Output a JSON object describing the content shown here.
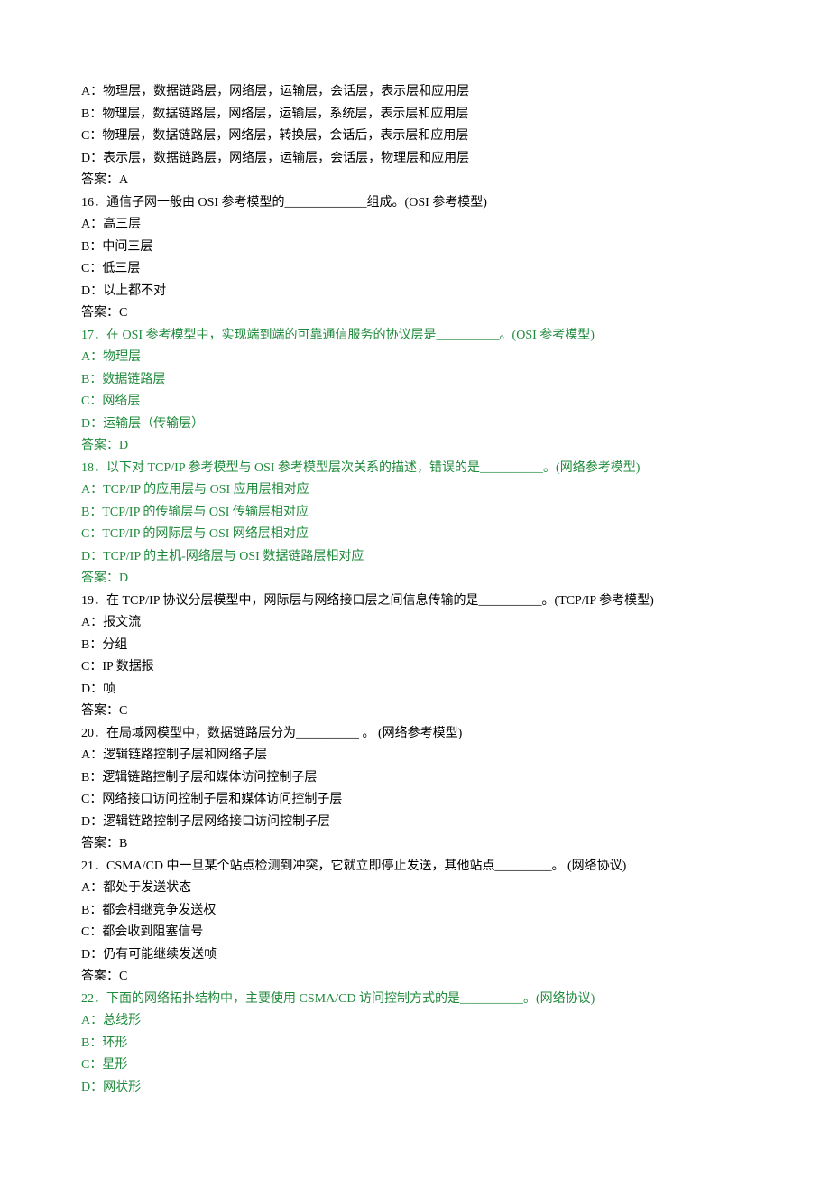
{
  "lines": [
    {
      "text": "A：物理层，数据链路层，网络层，运输层，会话层，表示层和应用层",
      "color": null
    },
    {
      "text": "B：物理层，数据链路层，网络层，运输层，系统层，表示层和应用层",
      "color": null
    },
    {
      "text": "C：物理层，数据链路层，网络层，转换层，会话后，表示层和应用层",
      "color": null
    },
    {
      "text": "D：表示层，数据链路层，网络层，运输层，会话层，物理层和应用层",
      "color": null
    },
    {
      "text": "答案：A",
      "color": null
    },
    {
      "text": "16．通信子网一般由 OSI 参考模型的_____________组成。(OSI 参考模型)",
      "color": null
    },
    {
      "text": "A：高三层",
      "color": null
    },
    {
      "text": "B：中间三层",
      "color": null
    },
    {
      "text": "C：低三层",
      "color": null
    },
    {
      "text": "D：以上都不对",
      "color": null
    },
    {
      "text": "答案：C",
      "color": null
    },
    {
      "text": "17．在 OSI 参考模型中，实现端到端的可靠通信服务的协议层是__________。(OSI 参考模型)",
      "color": "ci"
    },
    {
      "text": "A：物理层",
      "color": "ci"
    },
    {
      "text": "B：数据链路层",
      "color": "ci"
    },
    {
      "text": "C：网络层",
      "color": "ci"
    },
    {
      "text": "D：运输层（传输层）",
      "color": "ci"
    },
    {
      "text": "答案：D",
      "color": "ci"
    },
    {
      "text": "18．以下对 TCP/IP 参考模型与 OSI 参考模型层次关系的描述，错误的是__________。(网络参考模型)",
      "color": "ci"
    },
    {
      "text": "A：TCP/IP 的应用层与 OSI 应用层相对应",
      "color": "ci"
    },
    {
      "text": "B：TCP/IP 的传输层与 OSI 传输层相对应",
      "color": "ci"
    },
    {
      "text": "C：TCP/IP 的网际层与 OSI 网络层相对应",
      "color": "ci"
    },
    {
      "text": "D：TCP/IP 的主机-网络层与 OSI 数据链路层相对应",
      "color": "ci"
    },
    {
      "text": "答案：D",
      "color": "ci"
    },
    {
      "text": "19．在 TCP/IP 协议分层模型中，网际层与网络接口层之间信息传输的是__________。(TCP/IP 参考模型)",
      "color": null
    },
    {
      "text": "A：报文流",
      "color": null
    },
    {
      "text": "B：分组",
      "color": null
    },
    {
      "text": "C：IP 数据报",
      "color": null
    },
    {
      "text": "D：帧",
      "color": null
    },
    {
      "text": "答案：C",
      "color": null
    },
    {
      "text": "20．在局域网模型中，数据链路层分为__________ 。 (网络参考模型)",
      "color": null
    },
    {
      "text": "A：逻辑链路控制子层和网络子层",
      "color": null
    },
    {
      "text": "B：逻辑链路控制子层和媒体访问控制子层",
      "color": null
    },
    {
      "text": "C：网络接口访问控制子层和媒体访问控制子层",
      "color": null
    },
    {
      "text": "D：逻辑链路控制子层网络接口访问控制子层",
      "color": null
    },
    {
      "text": "答案：B",
      "color": null
    },
    {
      "text": "21．CSMA/CD 中一旦某个站点检测到冲突，它就立即停止发送，其他站点_________。 (网络协议)",
      "color": null
    },
    {
      "text": "A：都处于发送状态",
      "color": null
    },
    {
      "text": "B：都会相继竞争发送权",
      "color": null
    },
    {
      "text": "C：都会收到阻塞信号",
      "color": null
    },
    {
      "text": "D：仍有可能继续发送帧",
      "color": null
    },
    {
      "text": "答案：C",
      "color": null
    },
    {
      "text": "22．下面的网络拓扑结构中，主要使用 CSMA/CD 访问控制方式的是__________。(网络协议)",
      "color": "ci"
    },
    {
      "text": "A：总线形",
      "color": "ci"
    },
    {
      "text": "B：环形",
      "color": "ci"
    },
    {
      "text": "C：星形",
      "color": "ci"
    },
    {
      "text": "D：网状形",
      "color": "ci"
    }
  ]
}
